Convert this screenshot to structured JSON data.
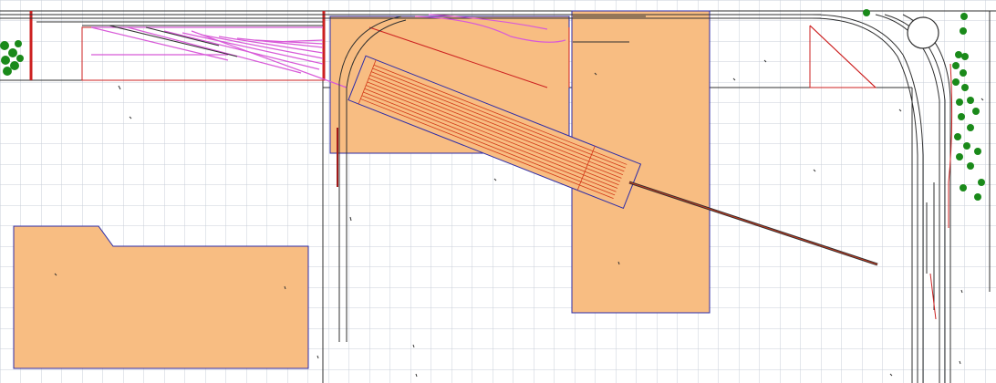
{
  "diagram": {
    "kind": "model railroad track plan",
    "colors": {
      "background": "#ffffff",
      "grid": "#c8cfd8",
      "structure_fill": "#f8bd82",
      "structure_stroke": "#2c2ca8",
      "track": "#303030",
      "track_highlight": "#d85ad8",
      "scenery_red": "#cc2020",
      "tree": "#1a8a1a",
      "pit_lines": "#d23a18"
    },
    "elements": [
      "staging-yard",
      "ladder-yard",
      "turntable-or-transfer-table",
      "long-spur",
      "loop-curve",
      "buildings",
      "trees"
    ]
  }
}
